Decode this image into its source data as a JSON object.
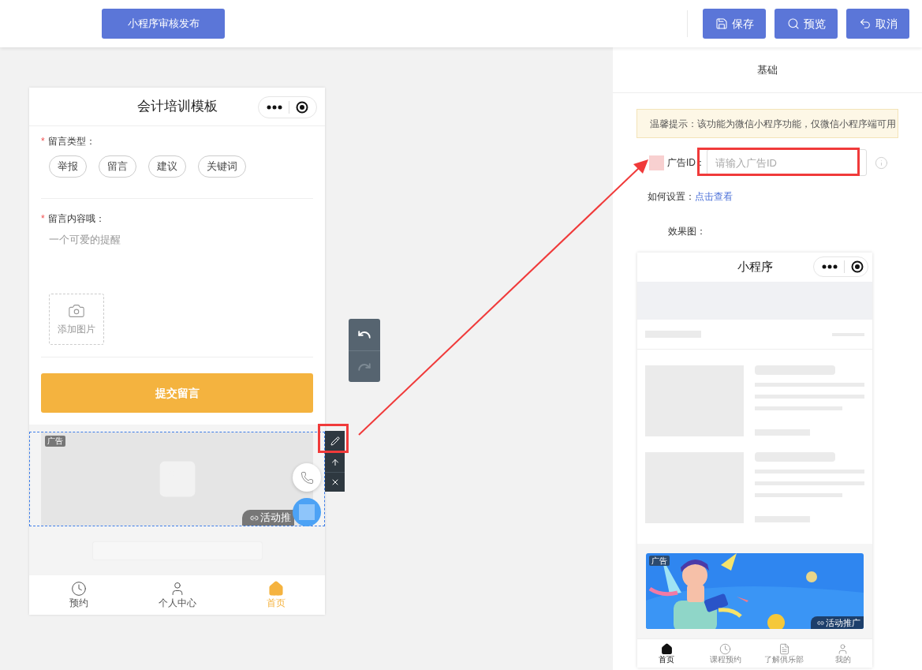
{
  "top_bar": {
    "publish_button": "小程序审核发布",
    "buttons": [
      {
        "kind": "save",
        "label": "保存"
      },
      {
        "kind": "preview",
        "label": "预览"
      },
      {
        "kind": "cancel",
        "label": "取消"
      }
    ]
  },
  "history": [
    {
      "kind": "undo",
      "disabled": false
    },
    {
      "kind": "redo",
      "disabled": true
    }
  ],
  "phone": {
    "title": "会计培训模板",
    "type_field": {
      "required_mark": "*",
      "label": "留言类型：",
      "options": [
        "举报",
        "留言",
        "建议",
        "关键词"
      ]
    },
    "content_field": {
      "required_mark": "*",
      "label": "留言内容哦：",
      "placeholder": "一个可爱的提醒"
    },
    "upload_label": "添加图片",
    "submit": "提交留言",
    "ad": {
      "badge": "广告",
      "promo": "活动推"
    },
    "tabs": [
      {
        "kind": "clock",
        "label": "预约",
        "selected": false
      },
      {
        "kind": "person",
        "label": "个人中心",
        "selected": false
      },
      {
        "kind": "home",
        "label": "首页",
        "selected": true
      }
    ]
  },
  "right_panel": {
    "tab": "基础",
    "notice": "温馨提示：该功能为微信小程序功能，仅微信小程序端可用",
    "ad_id_label": "广告ID：",
    "ad_id_placeholder": "请输入广告ID",
    "how_label": "如何设置：",
    "how_link": "点击查看",
    "effect_label": "效果图：",
    "preview": {
      "title": "小程序",
      "ad_badge": "广告",
      "promo": "活动推广",
      "tabs": [
        {
          "kind": "home",
          "label": "首页",
          "selected": true
        },
        {
          "kind": "clock",
          "label": "课程预约",
          "selected": false
        },
        {
          "kind": "document",
          "label": "了解俱乐部",
          "selected": false
        },
        {
          "kind": "person",
          "label": "我的",
          "selected": false
        }
      ]
    }
  }
}
